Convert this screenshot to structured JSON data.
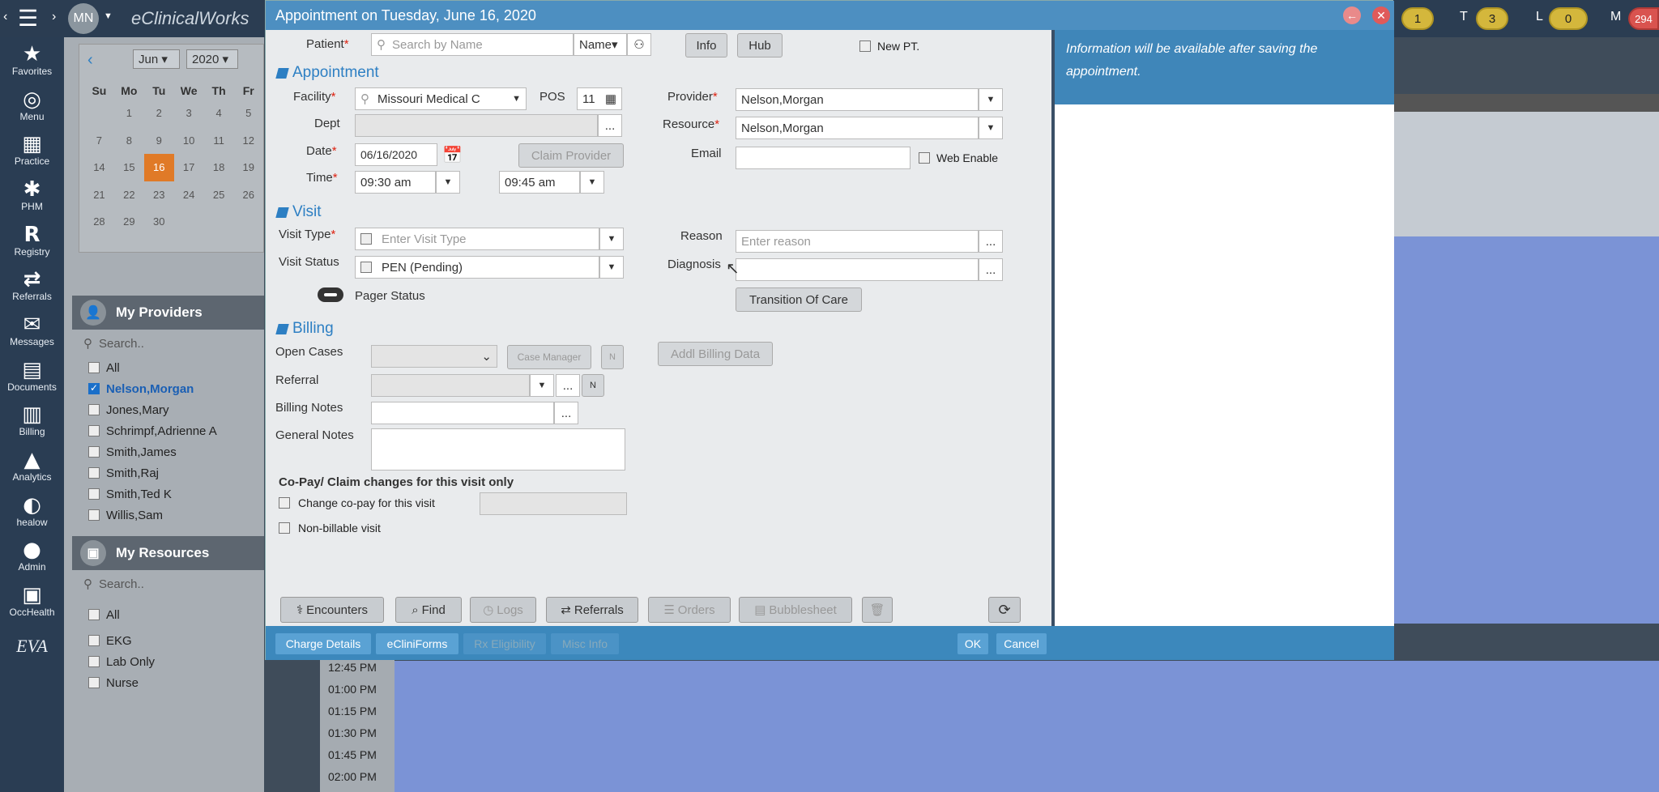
{
  "app": {
    "title": "eClinicalWorks",
    "user_initials": "MN",
    "counters": [
      {
        "label": "",
        "value": "1"
      },
      {
        "label": "T",
        "value": "3"
      },
      {
        "label": "L",
        "value": "0"
      },
      {
        "label": "M",
        "value": "294"
      }
    ]
  },
  "nav": {
    "items": [
      {
        "label": "Favorites",
        "icon": "star-icon",
        "glyph": "★"
      },
      {
        "label": "Menu",
        "icon": "menu-logo-icon",
        "glyph": "◎"
      },
      {
        "label": "Practice",
        "icon": "practice-icon",
        "glyph": "▦"
      },
      {
        "label": "PHM",
        "icon": "phm-icon",
        "glyph": "✱"
      },
      {
        "label": "Registry",
        "icon": "registry-icon",
        "glyph": "R"
      },
      {
        "label": "Referrals",
        "icon": "referrals-icon",
        "glyph": "⇄"
      },
      {
        "label": "Messages",
        "icon": "messages-icon",
        "glyph": "✉"
      },
      {
        "label": "Documents",
        "icon": "documents-icon",
        "glyph": "▤"
      },
      {
        "label": "Billing",
        "icon": "billing-icon",
        "glyph": "▥"
      },
      {
        "label": "Analytics",
        "icon": "analytics-icon",
        "glyph": "▲"
      },
      {
        "label": "healow",
        "icon": "healow-icon",
        "glyph": "◐"
      },
      {
        "label": "Admin",
        "icon": "admin-icon",
        "glyph": "●"
      },
      {
        "label": "OccHealth",
        "icon": "occhealth-icon",
        "glyph": "▣"
      }
    ],
    "eva": "EVA"
  },
  "calendar": {
    "month": "Jun",
    "year": "2020",
    "weekdays": [
      "Su",
      "Mo",
      "Tu",
      "We",
      "Th",
      "Fr"
    ],
    "weeks": [
      [
        "",
        "1",
        "2",
        "3",
        "4",
        "5"
      ],
      [
        "7",
        "8",
        "9",
        "10",
        "11",
        "12"
      ],
      [
        "14",
        "15",
        "16",
        "17",
        "18",
        "19"
      ],
      [
        "21",
        "22",
        "23",
        "24",
        "25",
        "26"
      ],
      [
        "28",
        "29",
        "30",
        "",
        "",
        ""
      ]
    ],
    "selected": "16"
  },
  "providers": {
    "title": "My Providers",
    "search_placeholder": "Search..",
    "items": [
      {
        "name": "All",
        "checked": false
      },
      {
        "name": "Nelson,Morgan",
        "checked": true
      },
      {
        "name": "Jones,Mary",
        "checked": false
      },
      {
        "name": "Schrimpf,Adrienne A",
        "checked": false
      },
      {
        "name": "Smith,James",
        "checked": false
      },
      {
        "name": "Smith,Raj",
        "checked": false
      },
      {
        "name": "Smith,Ted K",
        "checked": false
      },
      {
        "name": "Willis,Sam",
        "checked": false
      }
    ]
  },
  "resources": {
    "title": "My Resources",
    "search_placeholder": "Search..",
    "items": [
      "All",
      "EKG",
      "Lab Only",
      "Nurse"
    ]
  },
  "schedule": {
    "times": [
      "12:45 PM",
      "01:00 PM",
      "01:15 PM",
      "01:30 PM",
      "01:45 PM",
      "02:00 PM"
    ]
  },
  "dialog": {
    "title": "Appointment on Tuesday, June 16, 2020",
    "patient_label": "Patient",
    "patient_placeholder": "Search by Name",
    "name_select": "Name",
    "info_btn": "Info",
    "hub_btn": "Hub",
    "new_pt": "New PT.",
    "appointment_section": "Appointment",
    "facility_label": "Facility",
    "facility_value": "Missouri Medical C",
    "pos_label": "POS",
    "pos_value": "11",
    "dept_label": "Dept",
    "date_label": "Date",
    "date_value": "06/16/2020",
    "claim_provider": "Claim Provider",
    "time_label": "Time",
    "time_start": "09:30 am",
    "time_end": "09:45 am",
    "provider_label": "Provider",
    "provider_value": "Nelson,Morgan",
    "resource_label": "Resource",
    "resource_value": "Nelson,Morgan",
    "email_label": "Email",
    "web_enable": "Web Enable",
    "visit_section": "Visit",
    "visit_type_label": "Visit Type",
    "visit_type_placeholder": "Enter Visit Type",
    "visit_status_label": "Visit Status",
    "visit_status_value": "PEN (Pending)",
    "pager_status": "Pager Status",
    "reason_label": "Reason",
    "reason_placeholder": "Enter reason",
    "diagnosis_label": "Diagnosis",
    "transition_btn": "Transition Of Care",
    "billing_section": "Billing",
    "open_cases_label": "Open Cases",
    "case_manager": "Case Manager",
    "n": "N",
    "addl_billing": "Addl Billing Data",
    "referral_label": "Referral",
    "billing_notes_label": "Billing Notes",
    "general_notes_label": "General Notes",
    "copay_heading": "Co-Pay/ Claim changes for this visit only",
    "change_copay": "Change co-pay for this visit",
    "non_billable": "Non-billable visit",
    "ellipsis": "...",
    "info_text": "Information will be available after saving the appointment.",
    "toolbar": [
      "Encounters",
      "Find",
      "Logs",
      "Referrals",
      "Orders",
      "Bubblesheet"
    ],
    "bottom": [
      "Charge Details",
      "eCliniForms",
      "Rx Eligibility",
      "Misc Info"
    ],
    "ok": "OK",
    "cancel": "Cancel"
  },
  "colors": {
    "accent": "#4d8fc1",
    "selected_day": "#e07a27",
    "required": "#d21"
  }
}
